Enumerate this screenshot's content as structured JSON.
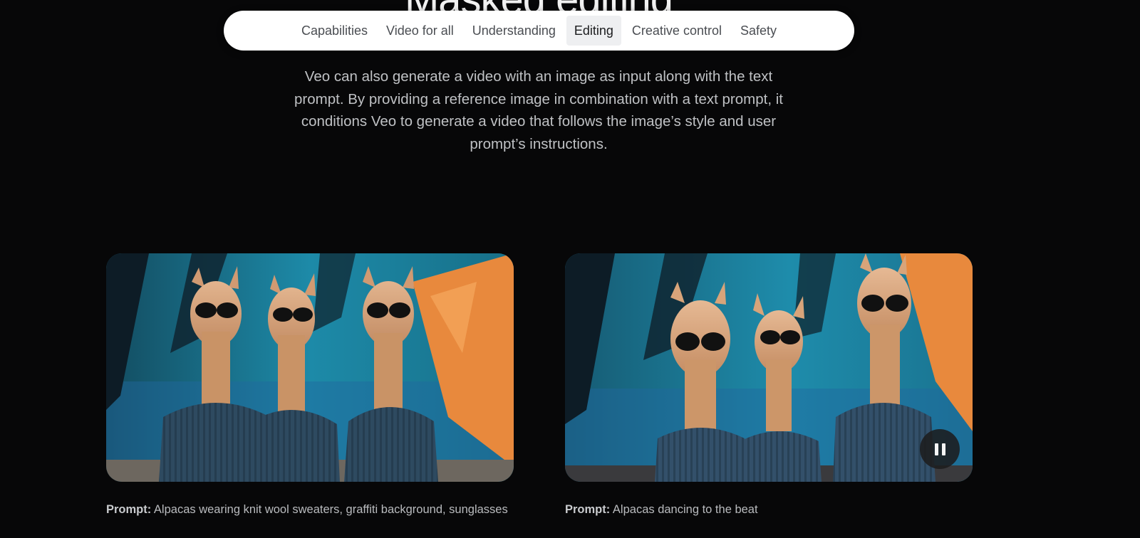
{
  "section": {
    "title": "Masked editing",
    "description": "Veo can also generate a video with an image as input along with the text prompt. By providing a reference image in combination with a text prompt, it conditions Veo to generate a video that follows the image’s style and user prompt’s instructions."
  },
  "nav": {
    "tabs": [
      {
        "label": "Capabilities",
        "active": false
      },
      {
        "label": "Video for all",
        "active": false
      },
      {
        "label": "Understanding",
        "active": false
      },
      {
        "label": "Editing",
        "active": true
      },
      {
        "label": "Creative control",
        "active": false
      },
      {
        "label": "Safety",
        "active": false
      }
    ]
  },
  "examples": [
    {
      "media_kind": "reference image",
      "subject": "three alpacas in knit sweaters with sunglasses, graffiti wall",
      "prompt_label": "Prompt:",
      "prompt_text": " Alpacas wearing knit wool sweaters, graffiti background, sunglasses"
    },
    {
      "media_kind": "generated video",
      "subject": "three alpacas dancing in sweaters and sunglasses, graffiti wall",
      "prompt_label": "Prompt:",
      "prompt_text": " Alpacas dancing to the beat",
      "control_icon": "pause-icon"
    }
  ],
  "colors": {
    "page_bg": "#070708",
    "nav_bg": "#ffffff",
    "nav_active_bg": "#eeeff1",
    "text_muted": "#bfc1c4",
    "graffiti_teal": "#1d8aa8",
    "graffiti_orange": "#e8893d",
    "sweater_blue": "#2e4a60",
    "alpaca_fur": "#d9a67d"
  }
}
